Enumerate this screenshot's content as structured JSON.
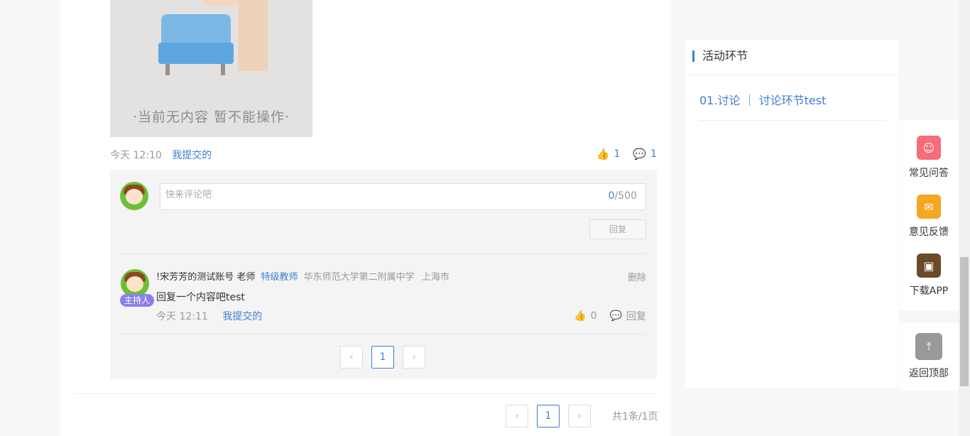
{
  "post": {
    "image_caption": "·当前无内容 暂不能操作·",
    "time": "今天 12:10",
    "tag": "我提交的",
    "likes": "1",
    "comments": "1"
  },
  "comment_box": {
    "placeholder": "快来评论吧",
    "count_current": "0",
    "count_max": "/500",
    "reply_label": "回复"
  },
  "comment": {
    "name": "!宋芳芳的测试账号 老师",
    "level": "特级教师",
    "school": "华东师范大学第二附属中学",
    "city": "上海市",
    "delete_label": "删除",
    "badge": "主持人",
    "content": "回复一个内容吧test",
    "time": "今天 12:11",
    "tag": "我提交的",
    "likes": "0",
    "reply_label": "回复"
  },
  "inner_pager": {
    "prev": "‹",
    "page": "1",
    "next": "›"
  },
  "outer_pager": {
    "prev": "‹",
    "page": "1",
    "next": "›",
    "total": "共1条/1页"
  },
  "sidebar": {
    "title": "活动环节",
    "link": "01.讨论 ｜ 讨论环节test"
  },
  "float_menu": {
    "faq": "常见问答",
    "feedback": "意见反馈",
    "download": "下载APP",
    "back_top": "返回顶部"
  },
  "colors": {
    "accent": "#3a7fd5",
    "faq": "#f56c7a",
    "feedback": "#f5a623",
    "back_top": "#999999"
  }
}
